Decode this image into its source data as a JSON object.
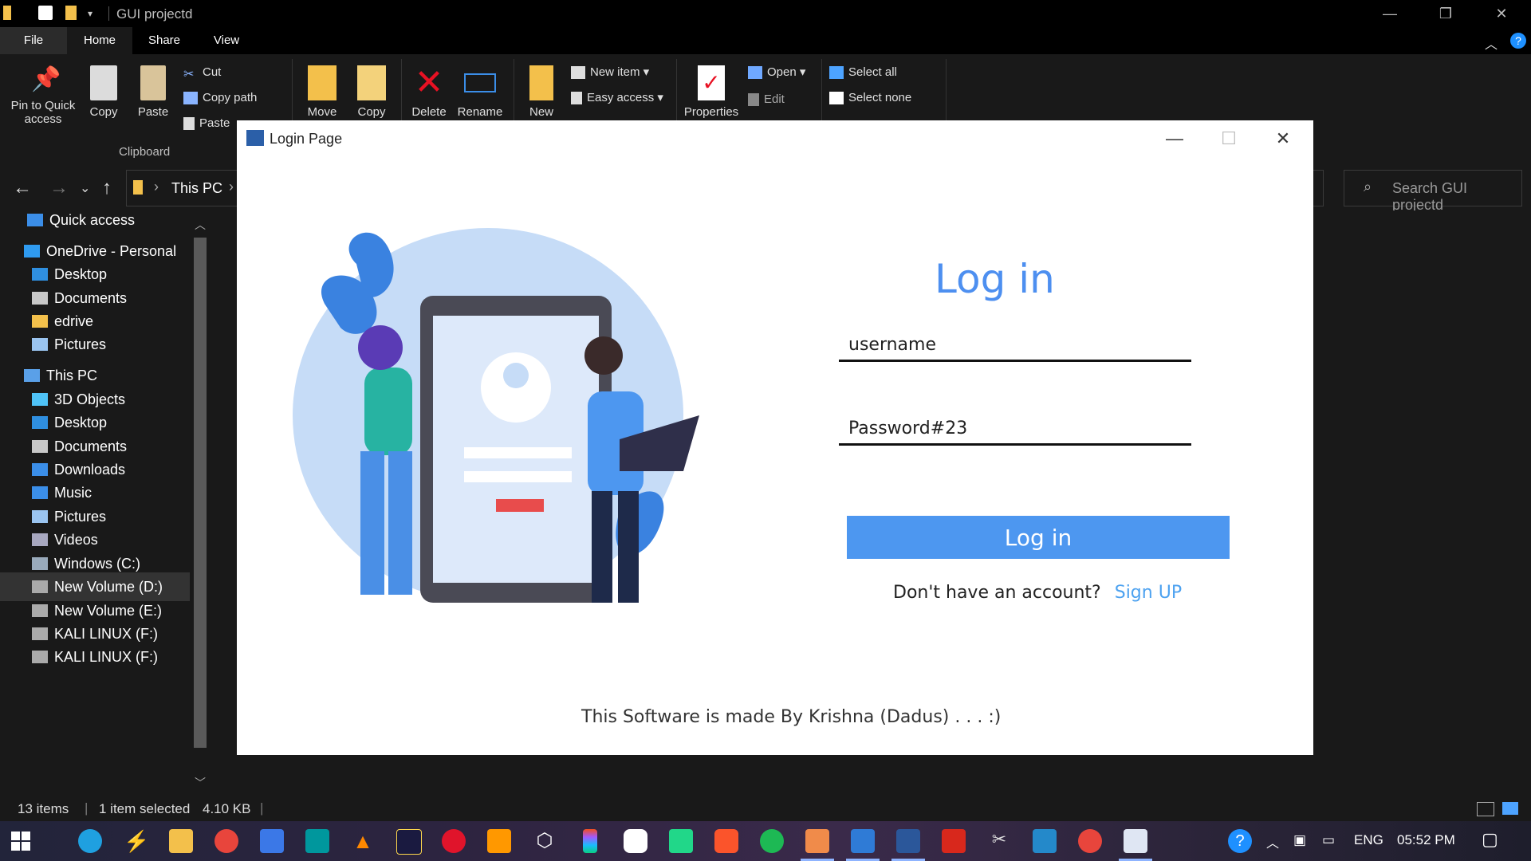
{
  "explorer": {
    "window_title": "GUI projectd",
    "tabs": [
      "File",
      "Home",
      "Share",
      "View"
    ],
    "ribbon": {
      "pin_label": "Pin to Quick",
      "pin_label2": "access",
      "copy_label": "Copy",
      "paste_label": "Paste",
      "cut_label": "Cut",
      "copy_path_label": "Copy path",
      "paste_shortcut_label": "Paste",
      "clipboard_group": "Clipboard",
      "move_label": "Move",
      "copy_to_label": "Copy",
      "delete_label": "Delete",
      "rename_label": "Rename",
      "new_label": "New",
      "new_item_label": "New item",
      "easy_access_label": "Easy access",
      "properties_label": "Properties",
      "open_label": "Open",
      "edit_label": "Edit",
      "select_all_label": "Select all",
      "select_none_label": "Select none"
    },
    "address": {
      "breadcrumb": "This PC",
      "search_placeholder": "Search GUI projectd"
    },
    "nav": {
      "items": [
        {
          "label": "Quick access",
          "icon": "star-icon"
        },
        {
          "label": "OneDrive - Personal",
          "icon": "cloud-icon"
        },
        {
          "label": "Desktop",
          "icon": "desktop-folder-icon"
        },
        {
          "label": "Documents",
          "icon": "documents-icon"
        },
        {
          "label": "edrive",
          "icon": "folder-icon"
        },
        {
          "label": "Pictures",
          "icon": "pictures-icon"
        },
        {
          "label": "This PC",
          "icon": "computer-icon"
        },
        {
          "label": "3D Objects",
          "icon": "cube-icon"
        },
        {
          "label": "Desktop",
          "icon": "desktop-folder-icon"
        },
        {
          "label": "Documents",
          "icon": "documents-icon"
        },
        {
          "label": "Downloads",
          "icon": "download-arrow-icon"
        },
        {
          "label": "Music",
          "icon": "music-note-icon"
        },
        {
          "label": "Pictures",
          "icon": "pictures-icon"
        },
        {
          "label": "Videos",
          "icon": "videos-icon"
        },
        {
          "label": "Windows (C:)",
          "icon": "windows-drive-icon"
        },
        {
          "label": "New Volume (D:)",
          "icon": "drive-icon"
        },
        {
          "label": "New Volume (E:)",
          "icon": "drive-icon"
        },
        {
          "label": "KALI LINUX (F:)",
          "icon": "drive-icon"
        },
        {
          "label": "KALI LINUX (F:)",
          "icon": "drive-icon"
        }
      ]
    },
    "status": {
      "items_count": "13 items",
      "selection": "1 item selected",
      "size": "4.10 KB"
    }
  },
  "dialog": {
    "title": "Login Page",
    "heading": "Log in",
    "username_value": "username",
    "password_value": "Password#23",
    "login_button": "Log in",
    "signup_prompt": "Don't have an account?",
    "signup_link": "Sign UP",
    "footer": "This Software is made By Krishna (Dadus) . . .  :)",
    "accent_color": "#4d97f0"
  },
  "taskbar": {
    "language": "ENG",
    "time": "05:52 PM"
  }
}
